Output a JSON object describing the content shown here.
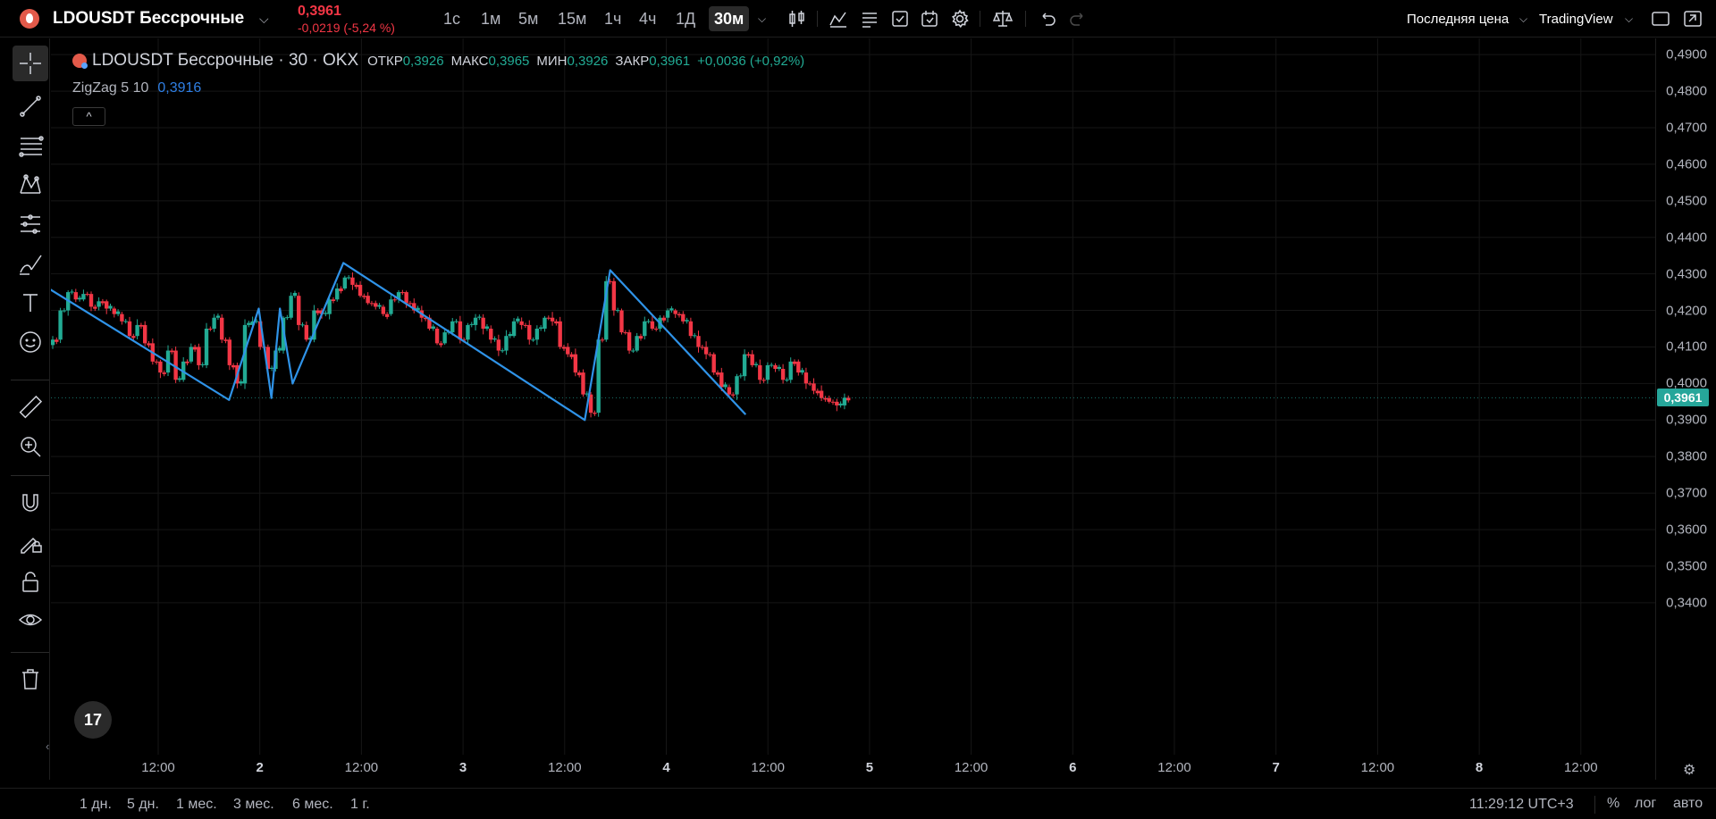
{
  "header": {
    "symbol": "LDOUSDT Бессрочные",
    "last_price": "0,3961",
    "change": "-0,0219 (-5,24 %)",
    "timeframes": [
      "1с",
      "1м",
      "5м",
      "15м",
      "1ч",
      "4ч",
      "1Д",
      "30м"
    ],
    "active_timeframe": "30м",
    "price_source": "Последняя цена",
    "brand": "TradingView"
  },
  "legend": {
    "title": "LDOUSDT Бессрочные · 30 · OKX",
    "open_label": "ОТКР",
    "open": "0,3926",
    "high_label": "МАКС",
    "high": "0,3965",
    "low_label": "МИН",
    "low": "0,3926",
    "close_label": "ЗАКР",
    "close": "0,3961",
    "change": "+0,0036 (+0,92%)",
    "indicator_name": "ZigZag 5 10",
    "indicator_value": "0,3916",
    "collapse_icon": "^"
  },
  "price_axis": {
    "ticks": [
      "0,4900",
      "0,4800",
      "0,4700",
      "0,4600",
      "0,4500",
      "0,4400",
      "0,4300",
      "0,4200",
      "0,4100",
      "0,4000",
      "0,3900",
      "0,3800",
      "0,3700",
      "0,3600",
      "0,3500",
      "0,3400"
    ],
    "last_price_tag": "0,3961"
  },
  "time_axis": {
    "ticks": [
      {
        "label": "12:00",
        "bold": false
      },
      {
        "label": "2",
        "bold": true
      },
      {
        "label": "12:00",
        "bold": false
      },
      {
        "label": "3",
        "bold": true
      },
      {
        "label": "12:00",
        "bold": false
      },
      {
        "label": "4",
        "bold": true
      },
      {
        "label": "12:00",
        "bold": false
      },
      {
        "label": "5",
        "bold": true
      },
      {
        "label": "12:00",
        "bold": false
      },
      {
        "label": "6",
        "bold": true
      },
      {
        "label": "12:00",
        "bold": false
      },
      {
        "label": "7",
        "bold": true
      },
      {
        "label": "12:00",
        "bold": false
      },
      {
        "label": "8",
        "bold": true
      },
      {
        "label": "12:00",
        "bold": false
      }
    ]
  },
  "bottom": {
    "ranges": [
      "1 дн.",
      "5 дн.",
      "1 мес.",
      "3 мес.",
      "6 мес.",
      "1 г."
    ],
    "clock": "11:29:12 UTC+3",
    "percent": "%",
    "log": "лог",
    "auto": "авто"
  },
  "watermark": "17",
  "colors": {
    "up": "#22ab94",
    "down": "#f23645",
    "zigzag": "#2f93e8",
    "last_price_tag": "#26a69a"
  },
  "chart_data": {
    "type": "candlestick",
    "indicator": "ZigZag 5 10",
    "ylim": [
      0.338,
      0.492
    ],
    "zigzag_points": [
      {
        "t": "1 05:00",
        "y": 0.427
      },
      {
        "t": "2 03:00",
        "y": 0.3955
      },
      {
        "t": "2 06:30",
        "y": 0.4205
      },
      {
        "t": "2 08:00",
        "y": 0.396
      },
      {
        "t": "2 09:00",
        "y": 0.4205
      },
      {
        "t": "2 10:30",
        "y": 0.4
      },
      {
        "t": "2 16:30",
        "y": 0.433
      },
      {
        "t": "3 21:00",
        "y": 0.39
      },
      {
        "t": "4 00:00",
        "y": 0.431
      },
      {
        "t": "4 16:00",
        "y": 0.3915
      }
    ],
    "close_series": [
      0.412,
      0.42,
      0.425,
      0.423,
      0.4245,
      0.421,
      0.4225,
      0.4205,
      0.419,
      0.417,
      0.413,
      0.416,
      0.411,
      0.406,
      0.403,
      0.409,
      0.401,
      0.406,
      0.41,
      0.405,
      0.415,
      0.418,
      0.412,
      0.405,
      0.4,
      0.416,
      0.417,
      0.41,
      0.404,
      0.409,
      0.418,
      0.424,
      0.416,
      0.412,
      0.42,
      0.419,
      0.423,
      0.426,
      0.429,
      0.427,
      0.424,
      0.422,
      0.421,
      0.419,
      0.423,
      0.425,
      0.422,
      0.42,
      0.418,
      0.415,
      0.411,
      0.414,
      0.417,
      0.412,
      0.416,
      0.418,
      0.415,
      0.412,
      0.409,
      0.413,
      0.417,
      0.416,
      0.412,
      0.415,
      0.418,
      0.417,
      0.41,
      0.408,
      0.403,
      0.397,
      0.392,
      0.412,
      0.428,
      0.42,
      0.414,
      0.409,
      0.413,
      0.417,
      0.415,
      0.418,
      0.42,
      0.419,
      0.417,
      0.413,
      0.41,
      0.408,
      0.403,
      0.399,
      0.397,
      0.402,
      0.408,
      0.405,
      0.401,
      0.405,
      0.404,
      0.401,
      0.406,
      0.403,
      0.4,
      0.398,
      0.396,
      0.395,
      0.394,
      0.3961
    ]
  }
}
